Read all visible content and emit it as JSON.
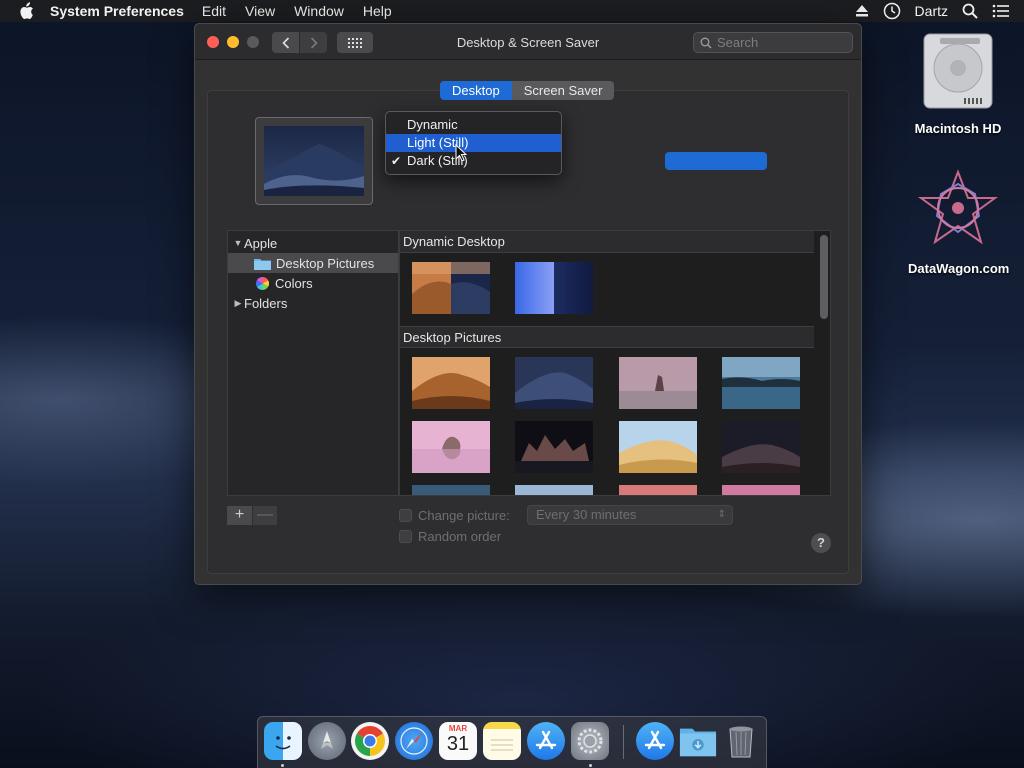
{
  "menubar": {
    "app_name": "System Preferences",
    "items": [
      "Edit",
      "View",
      "Window",
      "Help"
    ],
    "user": "Dartz"
  },
  "desktop_icons": [
    {
      "label": "Macintosh HD",
      "icon": "hard-drive-icon"
    },
    {
      "label": "DataWagon.com",
      "icon": "datawagon-logo-icon"
    }
  ],
  "window": {
    "title": "Desktop & Screen Saver",
    "search_placeholder": "Search",
    "tabs": [
      {
        "label": "Desktop",
        "active": true
      },
      {
        "label": "Screen Saver",
        "active": false
      }
    ]
  },
  "appearance_menu": {
    "items": [
      {
        "label": "Dynamic",
        "highlighted": false,
        "checked": false
      },
      {
        "label": "Light (Still)",
        "highlighted": true,
        "checked": false
      },
      {
        "label": "Dark (Still)",
        "highlighted": false,
        "checked": true
      }
    ]
  },
  "source_list": {
    "items": [
      {
        "label": "Apple",
        "type": "group",
        "expanded": true
      },
      {
        "label": "Desktop Pictures",
        "type": "folder",
        "selected": true
      },
      {
        "label": "Colors",
        "type": "colors",
        "selected": false
      },
      {
        "label": "Folders",
        "type": "group",
        "expanded": false
      }
    ]
  },
  "gallery": {
    "sections": [
      {
        "title": "Dynamic Desktop"
      },
      {
        "title": "Desktop Pictures"
      }
    ]
  },
  "controls": {
    "add_button": "+",
    "remove_button": "—",
    "change_picture_label": "Change picture:",
    "change_interval": "Every 30 minutes",
    "random_order_label": "Random order",
    "help_button": "?"
  },
  "dock": {
    "apps": [
      {
        "name": "Finder",
        "icon": "finder-icon",
        "running": true
      },
      {
        "name": "Launchpad",
        "icon": "launchpad-icon",
        "running": false
      },
      {
        "name": "Chrome",
        "icon": "chrome-icon",
        "running": false
      },
      {
        "name": "Safari",
        "icon": "safari-icon",
        "running": false
      },
      {
        "name": "Calendar",
        "icon": "calendar-icon",
        "running": false,
        "month": "MAR",
        "day": "31"
      },
      {
        "name": "Notes",
        "icon": "notes-icon",
        "running": false
      },
      {
        "name": "App Store",
        "icon": "app-store-icon",
        "running": false
      },
      {
        "name": "System Preferences",
        "icon": "system-preferences-icon",
        "running": true
      },
      {
        "name": "App Store Downloads",
        "icon": "app-store-icon",
        "running": false
      },
      {
        "name": "Downloads",
        "icon": "downloads-folder-icon",
        "running": false
      },
      {
        "name": "Trash",
        "icon": "trash-icon",
        "running": false
      }
    ]
  },
  "colors": {
    "accent": "#1f6bd6",
    "window_bg": "#323233",
    "close": "#ff5f57",
    "minimize": "#febc2e"
  }
}
